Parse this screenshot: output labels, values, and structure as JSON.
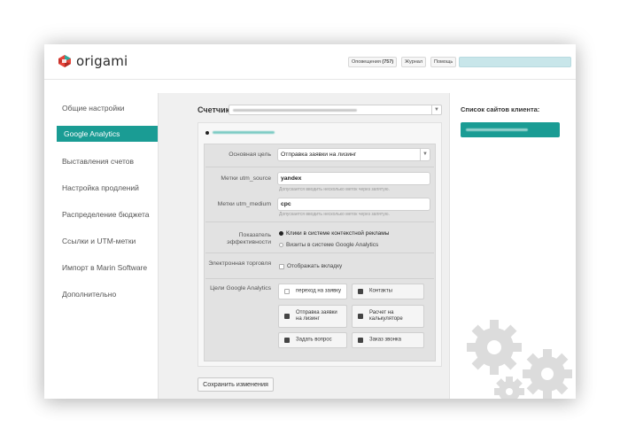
{
  "app": {
    "name": "origami"
  },
  "header": {
    "notifications_label": "Оповещения",
    "notifications_count": "(757)",
    "journal_label": "Журнал",
    "help_label": "Помощь"
  },
  "sidebar": {
    "items": [
      {
        "label": "Общие настройки",
        "active": false
      },
      {
        "label": "Google Analytics",
        "active": true
      },
      {
        "label": "Выставления счетов",
        "active": false
      },
      {
        "label": "Настройка продлений",
        "active": false
      },
      {
        "label": "Распределение бюджета",
        "active": false
      },
      {
        "label": "Ссылки и UTM-метки",
        "active": false
      },
      {
        "label": "Импорт в Marin Software",
        "active": false
      },
      {
        "label": "Дополнительно",
        "active": false
      }
    ]
  },
  "main": {
    "counter_label": "Счетчик",
    "form": {
      "main_goal_label": "Основная цель",
      "main_goal_value": "Отправка заявки на лизинг",
      "utm_source_label": "Метки utm_source",
      "utm_source_value": "yandex",
      "utm_source_hint": "Допускается вводить несколько меток через запятую.",
      "utm_medium_label": "Метки utm_medium",
      "utm_medium_value": "cpc",
      "utm_medium_hint": "Допускается вводить несколько меток через запятую.",
      "efficiency_label": "Показатель эффективности",
      "efficiency_options": [
        {
          "label": "Клики в системе контекстной рекламы",
          "selected": true
        },
        {
          "label": "Визиты в системе Google Analytics",
          "selected": false
        }
      ],
      "ecommerce_label": "Электронная торговля",
      "ecommerce_checkbox_label": "Отображать вкладку",
      "goals_label": "Цели Google Analytics",
      "goals": [
        {
          "label": "переход на заявку",
          "checked": false
        },
        {
          "label": "Контакты",
          "checked": true
        },
        {
          "label": "Отправка заявки на лизинг",
          "checked": true
        },
        {
          "label": "Расчет на калькуляторе",
          "checked": true
        },
        {
          "label": "Задать вопрос",
          "checked": true
        },
        {
          "label": "Заказ звонка",
          "checked": true
        }
      ]
    },
    "save_label": "Сохранить изменения"
  },
  "right_sidebar": {
    "title": "Список сайтов клиента:"
  },
  "colors": {
    "accent": "#1a9c94",
    "search_field": "#c8e6ea"
  }
}
